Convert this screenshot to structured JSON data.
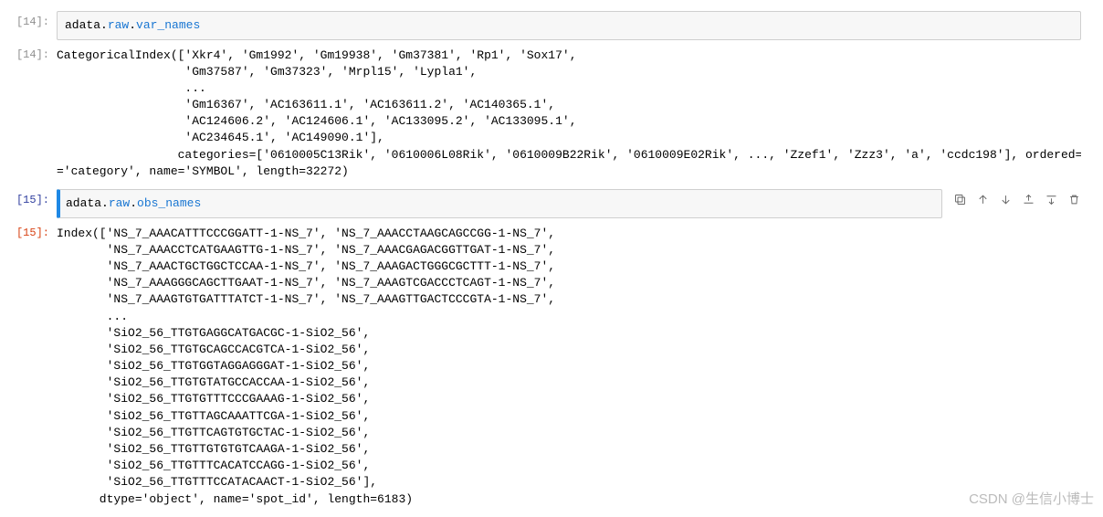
{
  "cells": {
    "in14": {
      "prompt": "[14]:",
      "code_prefix": "adata.",
      "code_attr1": "raw",
      "code_dot": ".",
      "code_attr2": "var_names"
    },
    "out14": {
      "prompt": "[14]:",
      "text": "CategoricalIndex(['Xkr4', 'Gm1992', 'Gm19938', 'Gm37381', 'Rp1', 'Sox17',\n                  'Gm37587', 'Gm37323', 'Mrpl15', 'Lypla1',\n                  ...\n                  'Gm16367', 'AC163611.1', 'AC163611.2', 'AC140365.1',\n                  'AC124606.2', 'AC124606.1', 'AC133095.2', 'AC133095.1',\n                  'AC234645.1', 'AC149090.1'],\n                 categories=['0610005C13Rik', '0610006L08Rik', '0610009B22Rik', '0610009E02Rik', ..., 'Zzef1', 'Zzz3', 'a', 'ccdc198'], ordered=False, dtype\n='category', name='SYMBOL', length=32272)"
    },
    "in15": {
      "prompt": "[15]:",
      "code_prefix": "adata.",
      "code_attr1": "raw",
      "code_dot": ".",
      "code_attr2": "obs_names"
    },
    "out15": {
      "prompt": "[15]:",
      "text": "Index(['NS_7_AAACATTTCCCGGATT-1-NS_7', 'NS_7_AAACCTAAGCAGCCGG-1-NS_7',\n       'NS_7_AAACCTCATGAAGTTG-1-NS_7', 'NS_7_AAACGAGACGGTTGAT-1-NS_7',\n       'NS_7_AAACTGCTGGCTCCAA-1-NS_7', 'NS_7_AAAGACTGGGCGCTTT-1-NS_7',\n       'NS_7_AAAGGGCAGCTTGAAT-1-NS_7', 'NS_7_AAAGTCGACCCTCAGT-1-NS_7',\n       'NS_7_AAAGTGTGATTTATCT-1-NS_7', 'NS_7_AAAGTTGACTCCCGTA-1-NS_7',\n       ...\n       'SiO2_56_TTGTGAGGCATGACGC-1-SiO2_56',\n       'SiO2_56_TTGTGCAGCCACGTCA-1-SiO2_56',\n       'SiO2_56_TTGTGGTAGGAGGGAT-1-SiO2_56',\n       'SiO2_56_TTGTGTATGCCACCAA-1-SiO2_56',\n       'SiO2_56_TTGTGTTTCCCGAAAG-1-SiO2_56',\n       'SiO2_56_TTGTTAGCAAATTCGA-1-SiO2_56',\n       'SiO2_56_TTGTTCAGTGTGCTAC-1-SiO2_56',\n       'SiO2_56_TTGTTGTGTGTCAAGA-1-SiO2_56',\n       'SiO2_56_TTGTTTCACATCCAGG-1-SiO2_56',\n       'SiO2_56_TTGTTTCCATACAACT-1-SiO2_56'],\n      dtype='object', name='spot_id', length=6183)"
    }
  },
  "watermark": "CSDN @生信小博士"
}
